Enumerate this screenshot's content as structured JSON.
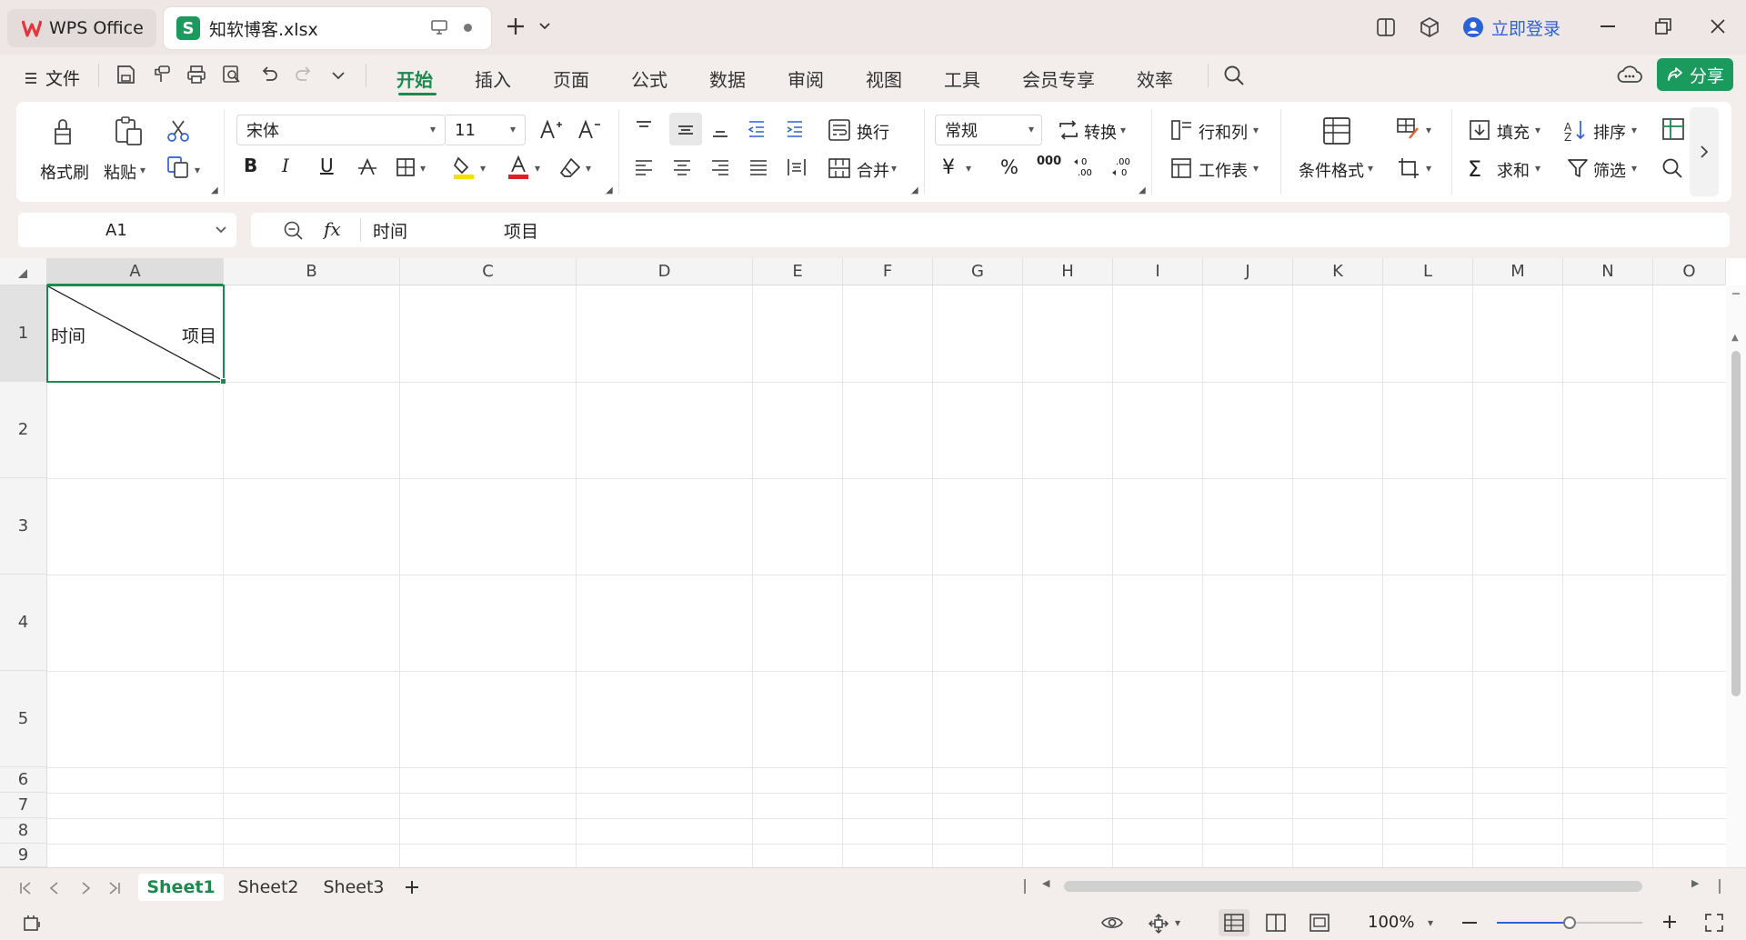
{
  "titlebar": {
    "app_tab": "WPS Office",
    "doc_tab": "知软博客.xlsx",
    "doc_badge": "S",
    "login": "立即登录"
  },
  "menu": {
    "file": "文件",
    "tabs": [
      "开始",
      "插入",
      "页面",
      "公式",
      "数据",
      "审阅",
      "视图",
      "工具",
      "会员专享",
      "效率"
    ],
    "active_tab": "开始",
    "share": "分享"
  },
  "ribbon": {
    "format_painter": "格式刷",
    "paste": "粘贴",
    "font_name": "宋体",
    "font_size": "11",
    "wrap": "换行",
    "merge": "合并",
    "number_format": "常规",
    "convert": "转换",
    "rows_cols": "行和列",
    "worksheet": "工作表",
    "cond_format": "条件格式",
    "fill": "填充",
    "sort": "排序",
    "sum": "求和",
    "filter": "筛选",
    "bold": "B",
    "italic": "I",
    "underline": "U"
  },
  "formula_bar": {
    "cell_ref": "A1",
    "fx": "fx",
    "content_left": "时间",
    "content_right": "项目"
  },
  "grid": {
    "columns": [
      "A",
      "B",
      "C",
      "D",
      "E",
      "F",
      "G",
      "H",
      "I",
      "J",
      "K",
      "L",
      "M",
      "N",
      "O"
    ],
    "rows": [
      "1",
      "2",
      "3",
      "4",
      "5",
      "6",
      "7",
      "8",
      "9"
    ],
    "selected_cell": "A1",
    "a1_left": "时间",
    "a1_right": "项目"
  },
  "sheets": [
    "Sheet1",
    "Sheet2",
    "Sheet3"
  ],
  "active_sheet": "Sheet1",
  "status": {
    "zoom": "100%",
    "zoom_fraction": 0.5
  },
  "colors": {
    "accent": "#1a8a4e",
    "login_blue": "#2b61d9",
    "wps_red": "#e8333a"
  }
}
